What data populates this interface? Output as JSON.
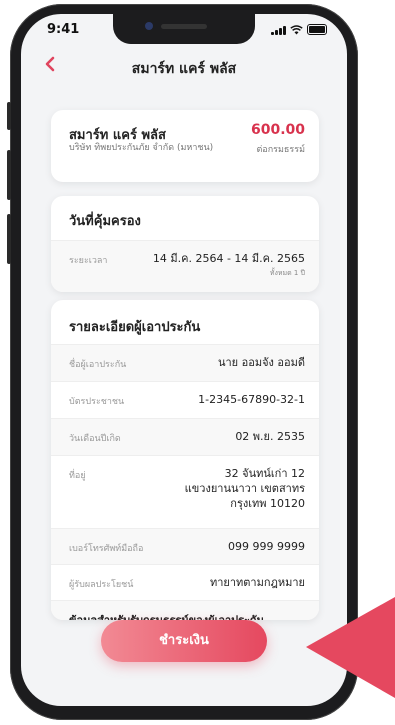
{
  "status": {
    "time": "9:41"
  },
  "header": {
    "back_icon": "chevron-left-icon",
    "title": "สมาร์ท แคร์ พลัส"
  },
  "plan": {
    "name": "สมาร์ท แคร์ พลัส",
    "company": "บริษัท ทิพยประกันภัย จำกัด (มหาชน)",
    "price": "600.00",
    "price_unit": "ต่อกรมธรรม์"
  },
  "coverage": {
    "title": "วันที่คุ้มครอง",
    "label": "ระยะเวลา",
    "range": "14 มี.ค. 2564 - 14 มี.ค. 2565",
    "total": "ทั้งหมด 1 ปี"
  },
  "insured": {
    "title": "รายละเอียดผู้เอาประกัน",
    "rows": [
      {
        "label": "ชื่อผู้เอาประกัน",
        "value": "นาย ออมจัง ออมดี"
      },
      {
        "label": "บัตรประชาชน",
        "value": "1-2345-67890-32-1"
      },
      {
        "label": "วันเดือนปีเกิด",
        "value": "02 พ.ย. 2535"
      },
      {
        "label": "ที่อยู่",
        "value_lines": [
          "32 จันทน์เก่า 12",
          "แขวงยานนาวา เขตสาทร",
          "กรุงเทพ 10120"
        ]
      },
      {
        "label": "เบอร์โทรศัพท์มือถือ",
        "value": "099 999 9999"
      },
      {
        "label": "ผู้รับผลประโยชน์",
        "value": "ทายาทตามกฎหมาย"
      }
    ],
    "next_section": "ข้อมลสำหรับรับกรมธรรม์ของผู้เอาประกัน"
  },
  "pay_button": {
    "label": "ชำระเงิน"
  },
  "colors": {
    "accent": "#e5485f",
    "price": "#d8324d"
  }
}
